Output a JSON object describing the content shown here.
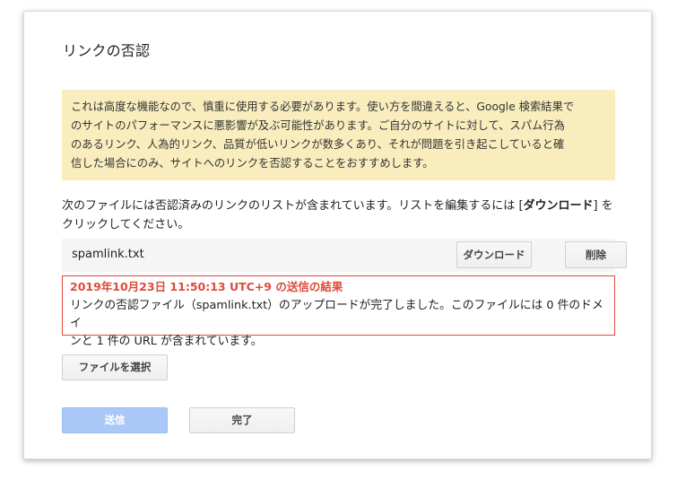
{
  "dialog": {
    "title": "リンクの否認",
    "warning": {
      "line1": "これは高度な機能なので、慎重に使用する必要があります。使い方を間違えると、Google 検索結果で",
      "line2": "のサイトのパフォーマンスに悪影響が及ぶ可能性があります。ご自分のサイトに対して、スパム行為",
      "line3": "のあるリンク、人為的リンク、品質が低いリンクが数多くあり、それが問題を引き起こしていると確",
      "line4": "信した場合にのみ、サイトへのリンクを否認することをおすすめします。"
    },
    "intro": {
      "before": "次のファイルには否認済みのリンクのリストが含まれています。リストを編集するには [",
      "emphasis": "ダウンロード",
      "after": "] を",
      "line2": "クリックしてください。"
    },
    "file": {
      "name": "spamlink.txt",
      "download_label": "ダウンロード",
      "delete_label": "削除"
    },
    "result": {
      "title": "2019年10月23日 11:50:13 UTC+9 の送信の結果",
      "line1": "リンクの否認ファイル（spamlink.txt）のアップロードが完了しました。このファイルには 0 件のドメイ",
      "line2": "ンと 1 件の URL が含まれています。"
    },
    "choose_file_label": "ファイルを選択",
    "send_label": "送信",
    "done_label": "完了",
    "colors": {
      "warning_bg": "#f9edbe",
      "error": "#dd4b39",
      "send_disabled": "#a9c8f7"
    }
  }
}
